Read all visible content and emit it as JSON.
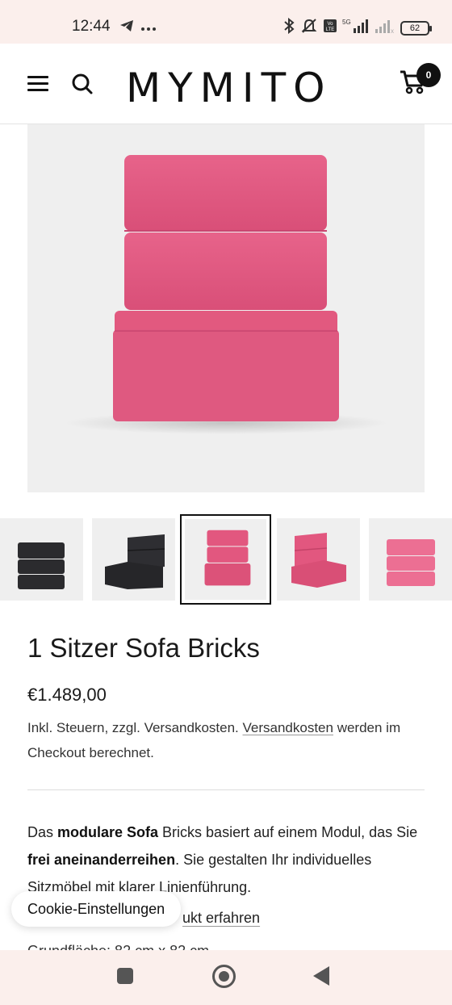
{
  "status_bar": {
    "time": "12:44",
    "icons": [
      "telegram-icon",
      "more-dots-icon",
      "bluetooth-icon",
      "mute-icon",
      "volte-icon",
      "signal-5g-icon",
      "signal-icon"
    ],
    "battery": "62"
  },
  "header": {
    "logo": "MYMITO",
    "cart_count": "0"
  },
  "product": {
    "main_image_color": "#e2577f",
    "thumbnails": [
      {
        "color": "#2b2b2e"
      },
      {
        "color": "#2b2b2e"
      },
      {
        "color": "#e2577f",
        "active": true
      },
      {
        "color": "#e2577f"
      },
      {
        "color": "#ec6f93"
      }
    ],
    "title": "1 Sitzer Sofa Bricks",
    "price": "€1.489,00",
    "tax_note_part1": "Inkl. Steuern, zzgl. Versandkosten.",
    "tax_note_link": "Versandkosten",
    "tax_note_part2": "werden im Checkout berechnet.",
    "desc_1": "Das ",
    "desc_bold_1": "modulare Sofa",
    "desc_2": " Bricks basiert auf einem Modul, das Sie ",
    "desc_bold_2": "frei aneinanderreihen",
    "desc_3": ". Sie gestalten Ihr individuelles Sitzmöbel mit klarer Linienführung.",
    "more_link": "ukt erfahren",
    "partial_text": "Grundfläche: 82 cm x 82 cm"
  },
  "cookie": {
    "label": "Cookie-Einstellungen"
  },
  "colors": {
    "accent_pink": "#e2577f",
    "dark": "#111111",
    "system_bar": "#fbefec"
  }
}
